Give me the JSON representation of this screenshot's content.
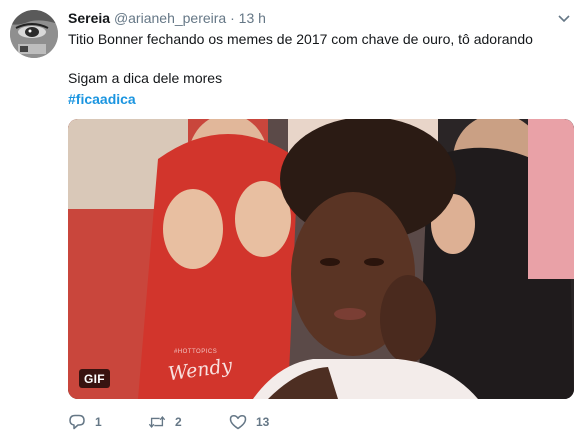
{
  "tweet": {
    "display_name": "Sereia",
    "handle": "@arianeh_pereira",
    "separator": "·",
    "time": "13 h",
    "text_line1": "Titio Bonner fechando os memes de 2017 com chave de ouro, tô adorando",
    "text_line2": "Sigam a dica dele mores",
    "hashtag": "#ficaadica",
    "media": {
      "badge": "GIF",
      "watermark_top": "#HOTTOPICS",
      "watermark_logo": "Wendy"
    },
    "actions": {
      "reply_count": "1",
      "retweet_count": "2",
      "like_count": "13"
    },
    "colors": {
      "accent": "#1b95e0",
      "secondary_text": "#657786"
    },
    "icons": {
      "caret": "chevron-down-icon",
      "reply": "reply-icon",
      "retweet": "retweet-icon",
      "like": "heart-icon"
    }
  }
}
